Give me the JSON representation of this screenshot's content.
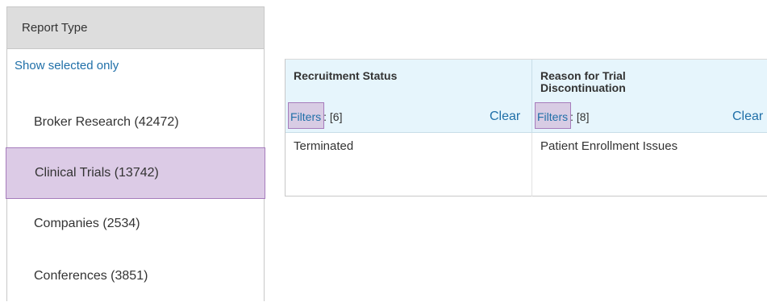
{
  "report_type": {
    "header": "Report Type",
    "show_selected_label": "Show selected only",
    "items": [
      {
        "label": "Broker Research (42472)",
        "selected": false
      },
      {
        "label": "Clinical Trials (13742)",
        "selected": true
      },
      {
        "label": "Companies (2534)",
        "selected": false
      },
      {
        "label": "Conferences (3851)",
        "selected": false
      }
    ]
  },
  "table": {
    "columns": [
      {
        "title": "Recruitment Status",
        "filters_label": "Filters",
        "filters_count": ": [6]",
        "clear_label": "Clear",
        "value": "Terminated"
      },
      {
        "title": "Reason for Trial Discontinuation",
        "filters_label": "Filters",
        "filters_count": ": [8]",
        "clear_label": "Clear",
        "value": "Patient Enrollment Issues"
      }
    ]
  },
  "colors": {
    "link": "#1f6fa8",
    "selected_bg": "#dccbe6",
    "selected_border": "#a67cbc",
    "header_bg": "#e6f5fc",
    "panel_header_bg": "#dddddd"
  }
}
